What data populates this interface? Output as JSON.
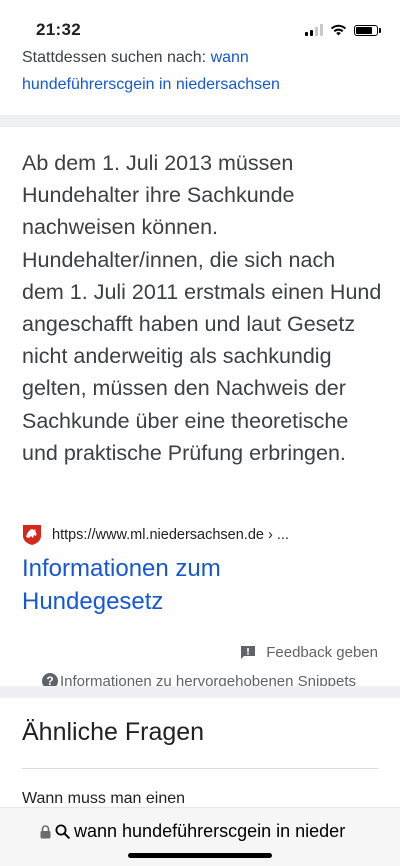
{
  "status_bar": {
    "time": "21:32",
    "battery_level": 0.85
  },
  "spelling": {
    "prefix": "Stattdessen suchen nach: ",
    "link": "wann hundeführerscgein in niedersachsen"
  },
  "featured_snippet": {
    "text": "Ab dem 1. Juli 2013 müssen Hundehalter ihre Sachkunde nachweisen können. Hundehalter/innen, die sich nach dem 1. Juli 2011 erstmals einen Hund angeschafft haben und laut Gesetz nicht anderweitig als sachkundig gelten, müssen den Nachweis der Sachkunde über eine theoretische und praktische Prüfung erbringen.",
    "source_url": "https://www.ml.niedersachsen.de › ...",
    "result_title": "Informationen zum Hundegesetz",
    "feedback_label": "Feedback geben",
    "info_label": "Informationen zu hervorgehobenen Snippets"
  },
  "related": {
    "title": "Ähnliche Fragen",
    "questions": [
      "Wann muss man einen"
    ]
  },
  "url_bar": {
    "text": "wann hundeführerscgein in nieder"
  },
  "colors": {
    "link": "#1558d6",
    "band": "#eef0f3",
    "text": "#3c4043"
  }
}
